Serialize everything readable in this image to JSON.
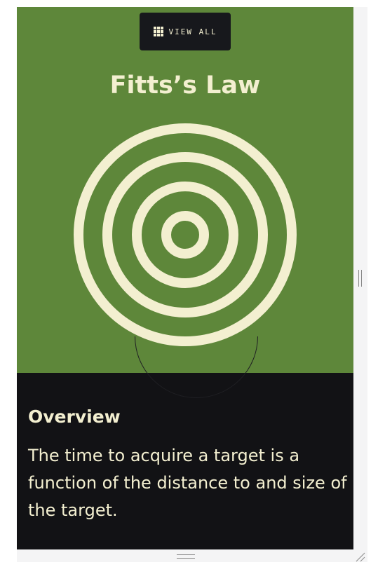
{
  "toolbar": {
    "view_all_label": "VIEW ALL",
    "view_all_icon": "grid-icon"
  },
  "hero": {
    "title": "Fitts’s Law",
    "illustration": "target-icon",
    "background_color": "#5e873a",
    "foreground_color": "#f3efd0"
  },
  "overview": {
    "heading": "Overview",
    "text": "The time to acquire a target is a function of the distance to and size of the target."
  },
  "colors": {
    "panel_background": "#121215",
    "button_background": "#17181c"
  }
}
